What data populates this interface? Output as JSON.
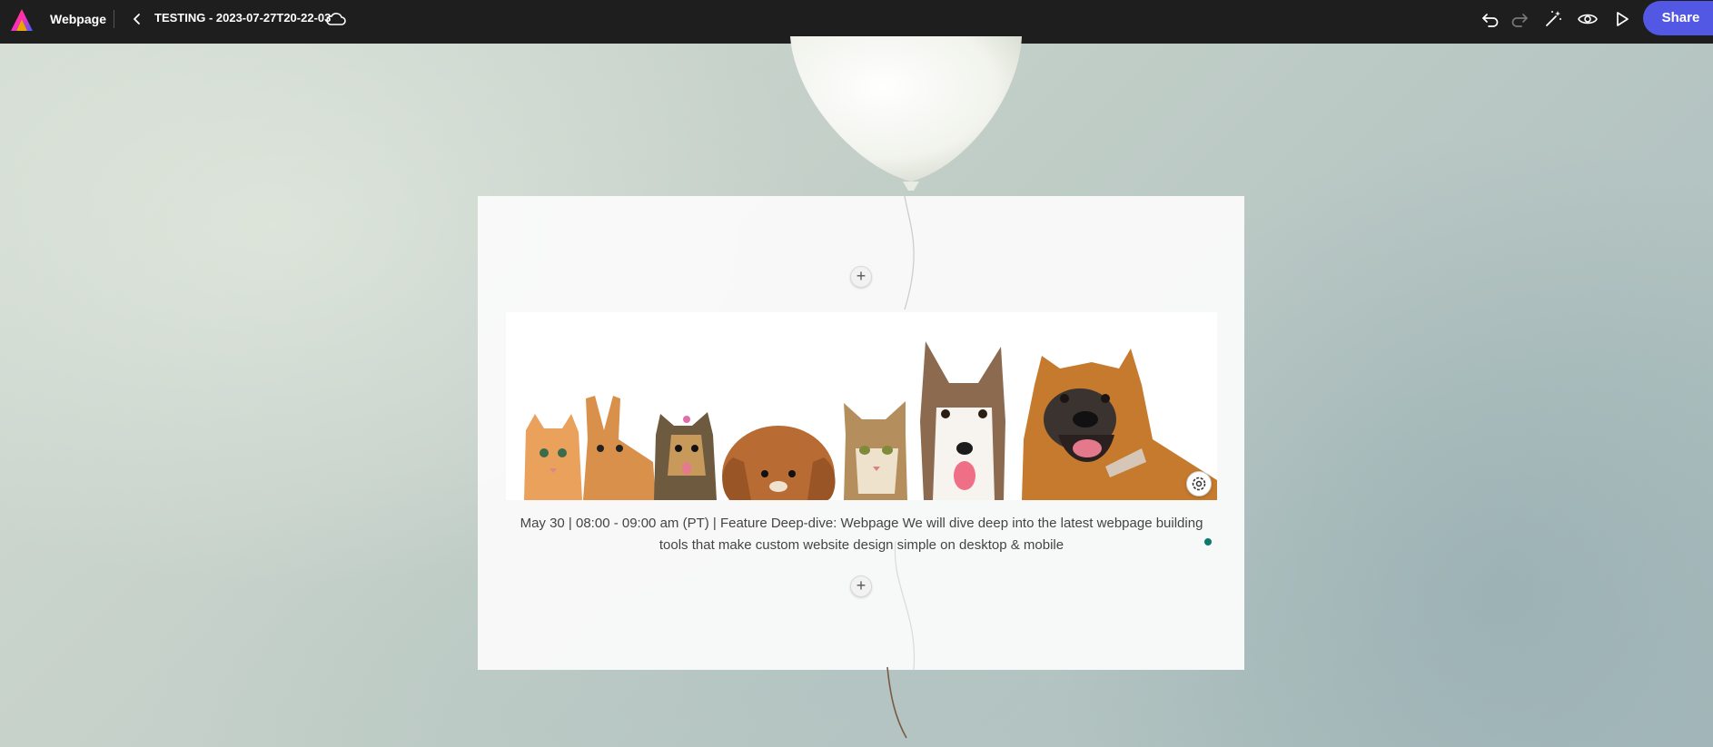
{
  "topbar": {
    "app_name": "Webpage",
    "doc_title": "TESTING - 2023-07-27T20-22-03",
    "share_label": "Share",
    "icons": [
      "adobe-express-logo",
      "back-chevron-icon",
      "cloud-icon",
      "undo-icon",
      "redo-icon",
      "magic-wand-icon",
      "preview-eye-icon",
      "play-icon"
    ]
  },
  "card": {
    "caption": "May 30 | 08:00 - 09:00 am (PT) | Feature Deep-dive: Webpage We will dive deep into the latest webpage building tools that make custom website design simple on desktop & mobile",
    "add_symbol": "+",
    "banner_alt": "Cats, rabbits and dogs peeking over a white edge"
  },
  "colors": {
    "topbar_bg": "#1e1e1e",
    "share_bg": "#5258e4",
    "status_dot": "#0d7a6b"
  }
}
